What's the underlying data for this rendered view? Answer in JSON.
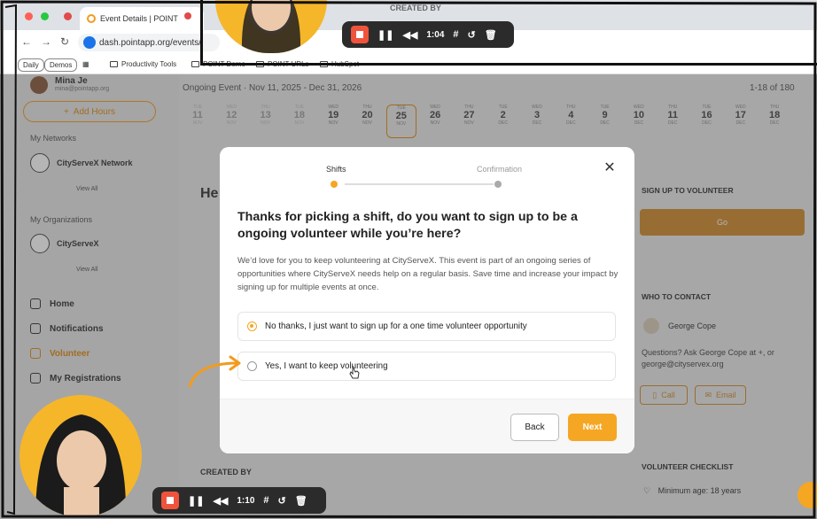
{
  "browser": {
    "tab_title": "Event Details | POINT",
    "url": "dash.pointapp.org/events/",
    "bookmarks": [
      "Daily",
      "Demos",
      "Productivity Tools",
      "POINT Demo",
      "POINT URLs",
      "HubSpot"
    ]
  },
  "sidebar": {
    "user_name": "Mina Je",
    "user_email": "mina@pointapp.org",
    "add_hours": "Add Hours",
    "networks_title": "My Networks",
    "network_name": "CityServeX Network",
    "view_all": "View All",
    "orgs_title": "My Organizations",
    "org_name": "CityServeX",
    "menu": [
      {
        "label": "Home"
      },
      {
        "label": "Notifications"
      },
      {
        "label": "Volunteer"
      },
      {
        "label": "My Registrations"
      }
    ]
  },
  "event": {
    "header": "Ongoing Event  ·  Nov 11, 2025 - Dec 31, 2026",
    "count": "1-18 of 180",
    "heading_partial": "He",
    "created_by": "CREATED BY"
  },
  "dates": [
    {
      "dw": "TUE",
      "dn": "11",
      "dm": "NOV"
    },
    {
      "dw": "WED",
      "dn": "12",
      "dm": "NOV"
    },
    {
      "dw": "THU",
      "dn": "13",
      "dm": "NOV"
    },
    {
      "dw": "TUE",
      "dn": "18",
      "dm": "NOV"
    },
    {
      "dw": "WED",
      "dn": "19",
      "dm": "NOV"
    },
    {
      "dw": "THU",
      "dn": "20",
      "dm": "NOV"
    },
    {
      "dw": "TUE",
      "dn": "25",
      "dm": "NOV"
    },
    {
      "dw": "WED",
      "dn": "26",
      "dm": "NOV"
    },
    {
      "dw": "THU",
      "dn": "27",
      "dm": "NOV"
    },
    {
      "dw": "TUE",
      "dn": "2",
      "dm": "DEC"
    },
    {
      "dw": "WED",
      "dn": "3",
      "dm": "DEC"
    },
    {
      "dw": "THU",
      "dn": "4",
      "dm": "DEC"
    },
    {
      "dw": "TUE",
      "dn": "9",
      "dm": "DEC"
    },
    {
      "dw": "WED",
      "dn": "10",
      "dm": "DEC"
    },
    {
      "dw": "THU",
      "dn": "11",
      "dm": "DEC"
    },
    {
      "dw": "TUE",
      "dn": "16",
      "dm": "DEC"
    },
    {
      "dw": "WED",
      "dn": "17",
      "dm": "DEC"
    },
    {
      "dw": "THU",
      "dn": "18",
      "dm": "DEC"
    }
  ],
  "right": {
    "signup_title": "SIGN UP TO VOLUNTEER",
    "go_label": "Go",
    "contact_title": "WHO TO CONTACT",
    "contact_name": "George Cope",
    "contact_text": "Questions? Ask George Cope at +, or george@cityservex.org",
    "call_label": "Call",
    "email_label": "Email",
    "checklist_title": "VOLUNTEER CHECKLIST",
    "checklist_item": "Minimum age: 18 years"
  },
  "modal": {
    "step1": "Shifts",
    "step2": "Confirmation",
    "title": "Thanks for picking a shift, do you want to sign up to be a ongoing volunteer while you’re here?",
    "body": "We’d love for you to keep volunteering at CityServeX. This event is part of an ongoing series of opportunities where CityServeX needs help on a regular basis. Save time and increase your impact by signing up for multiple events at once.",
    "option1": "No thanks, I just want to sign up for a one time volunteer opportunity",
    "option2": "Yes, I want to keep volunteering",
    "back_label": "Back",
    "next_label": "Next"
  },
  "recorder": {
    "top_time": "1:04",
    "bottom_time": "1:10"
  },
  "colors": {
    "accent": "#f5a623",
    "accent_dark": "#d18b2e",
    "recorder_bg": "#2b2b2b",
    "stop_red": "#f0533c"
  }
}
